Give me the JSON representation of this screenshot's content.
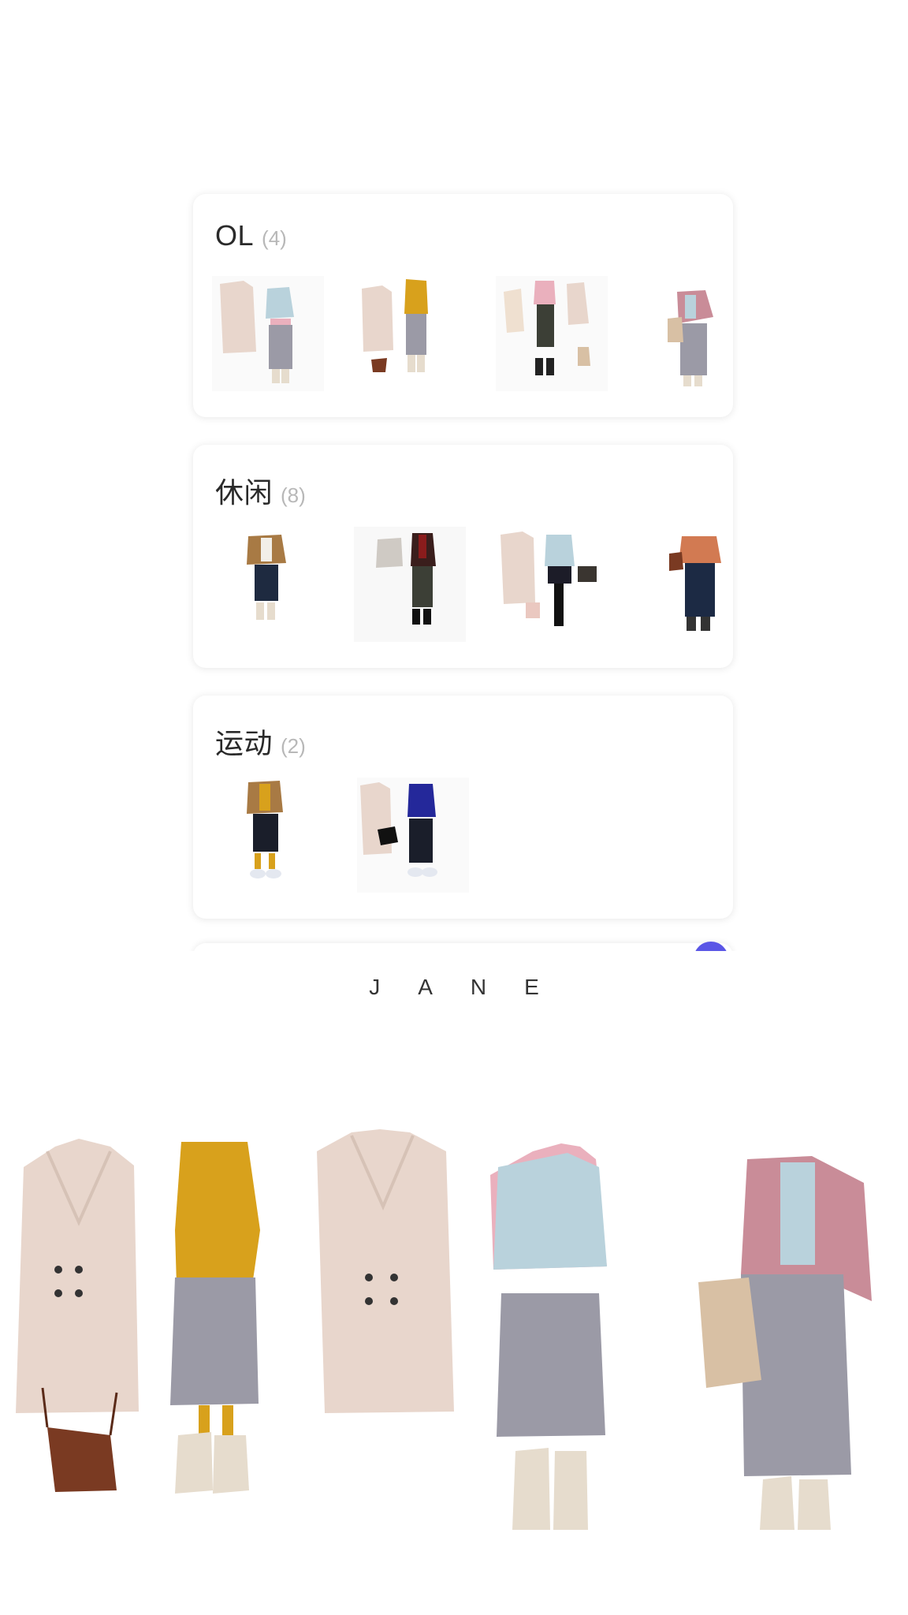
{
  "categories": [
    {
      "name": "OL",
      "count": "(4)"
    },
    {
      "name": "休闲",
      "count": "(8)"
    },
    {
      "name": "运动",
      "count": "(2)"
    }
  ],
  "brand": "JANE",
  "colors": {
    "coat": "#e8d6cc",
    "mustard": "#d8a11c",
    "sky": "#b9d2dc",
    "pink": "#eab0bd",
    "grey_pant": "#9b9aa6",
    "boot": "#e6dccd",
    "bag": "#7a3a22",
    "accent": "#5a56e6"
  }
}
